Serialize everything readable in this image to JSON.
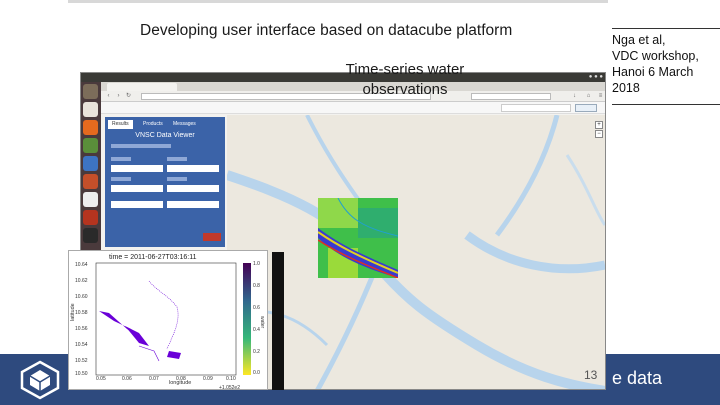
{
  "slide": {
    "title": "Developing user interface based on datacube platform",
    "attribution": [
      "Nga et al,",
      "VDC workshop,",
      "Hanoi 6 March",
      "2018"
    ],
    "footer_text": "e data",
    "page_number": "13"
  },
  "screenshot": {
    "map_title": [
      "Time-series water",
      "observations"
    ],
    "app_panel": {
      "tabs": [
        "Results",
        "Products",
        "Messages"
      ],
      "title": "VNSC Data Viewer"
    },
    "overlay_plot": {
      "title": "time = 2011-06-27T03:16:11",
      "y_ticks": [
        "10.64",
        "10.62",
        "10.60",
        "10.58",
        "10.56",
        "10.54",
        "10.52",
        "10.50"
      ],
      "x_ticks": [
        "0.05",
        "0.06",
        "0.07",
        "0.08",
        "0.09",
        "0.10"
      ],
      "x_label": "longitude",
      "y_label": "latitude",
      "x_offset": "+1.052e2",
      "colorbar_ticks": [
        "1.0",
        "0.8",
        "0.6",
        "0.4",
        "0.2",
        "0.0"
      ],
      "colorbar_label": "water"
    }
  },
  "colors": {
    "footer": "#2e4a7e",
    "panel": "#3b63a8",
    "water_mask": "#6a00d8"
  }
}
